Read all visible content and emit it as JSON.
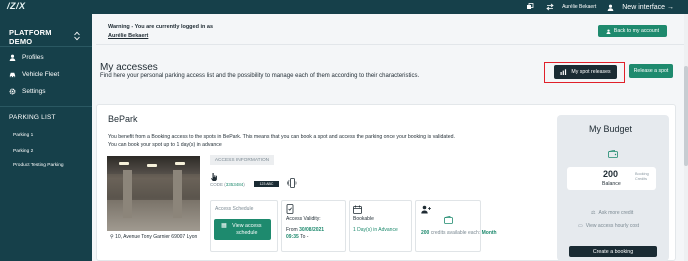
{
  "topbar": {
    "logo": "/Z/X",
    "user_name": "Aurélie Bekaert",
    "new_interface": "New interface →"
  },
  "sidebar": {
    "title": "PLATFORM DEMO",
    "items": [
      {
        "label": "Profiles",
        "icon": "user-icon"
      },
      {
        "label": "Vehicle Fleet",
        "icon": "car-icon"
      },
      {
        "label": "Settings",
        "icon": "gear-icon"
      }
    ],
    "parking_list_title": "PARKING LIST",
    "parkings": [
      "Parking 1",
      "Parking 2",
      "Product Testing Parking"
    ]
  },
  "header": {
    "warning": "Warning - You are currently logged in as",
    "warning_user": "Aurélie Bekaert",
    "back_button": "Back to my account"
  },
  "main": {
    "title": "My accesses",
    "subtitle": "Find here your personal parking access list and the possibility to manage each of them according to their characteristics.",
    "spot_releases_button": "My spot releases",
    "release_button": "Release a spot"
  },
  "bepark": {
    "title": "BePark",
    "line1": "You benefit from a Booking access to the spots in BePark. This means that you can book a spot and access the parking once your booking is validated.",
    "line2": "You can book your spot up to 1 day(s) in advance",
    "address": "10, Avenue Tony Garnier 69007 Lyon",
    "access_information": "ACCESS INFORMATION",
    "code_label": "CODE",
    "code_value": "3353484",
    "badge_text": "123 ABC",
    "access_schedule_label": "Access Schedule",
    "view_schedule_button": "View access schedule",
    "access_validity_label": "Access Validity:",
    "validity_from": "From",
    "validity_date": "30/08/2021",
    "validity_time": "09:35",
    "validity_to": "To -",
    "bookable_label": "Bookable",
    "bookable_value": "1 Day(s) in Advance",
    "credits_value": "200",
    "credits_text": "credits available each:",
    "credits_period": "Month"
  },
  "budget": {
    "title": "My Budget",
    "amount": "200",
    "credits_label": "Booking Credits",
    "balance_label": "Balance",
    "ask_more_credit": "Ask more credit",
    "view_hourly_cost": "View access hourly cost",
    "create_booking": "Create a booking"
  },
  "colors": {
    "sidebar_bg": "#16404a",
    "accent_green": "#1e8a6e",
    "dark_button": "#1a2b33",
    "highlight_red": "#e0202a"
  }
}
